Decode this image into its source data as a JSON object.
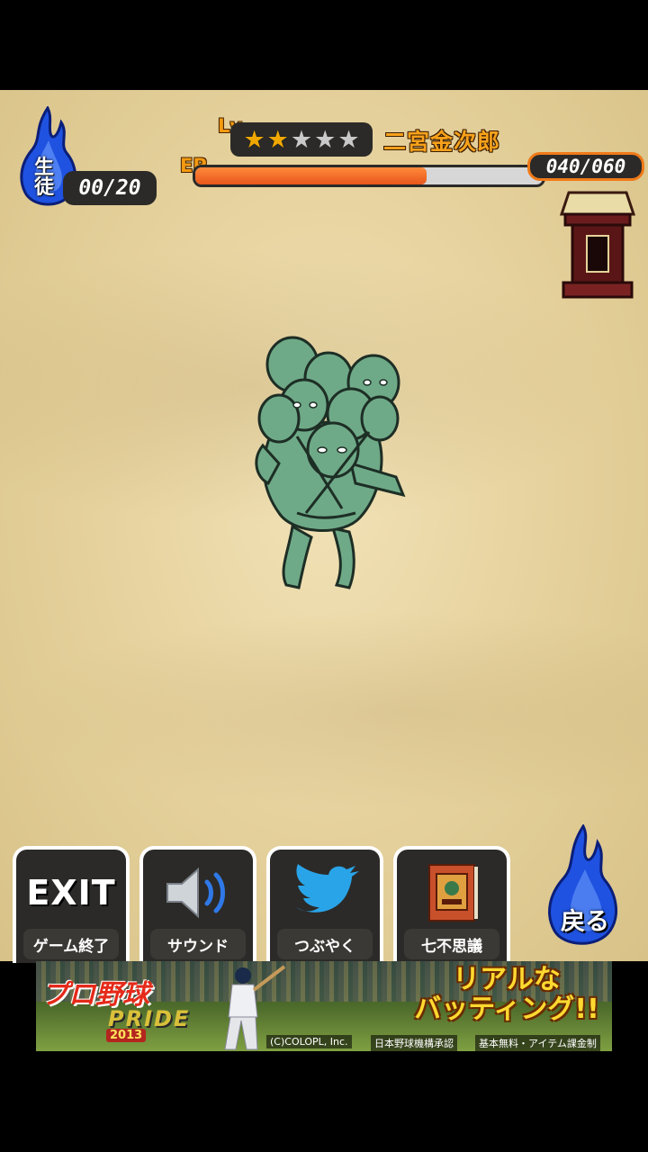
{
  "hud": {
    "students_label": "生徒",
    "students_count": "00/20",
    "lv_label": "Lv",
    "level_stars": 2,
    "level_max": 5,
    "character_name": "二宮金次郎",
    "ep_label": "EP",
    "ep_current": 40,
    "ep_max": 60,
    "ep_value": "040/060"
  },
  "menu": [
    {
      "id": "exit",
      "icon_text": "EXIT",
      "label": "ゲーム終了",
      "icon": "exit-icon"
    },
    {
      "id": "sound",
      "label": "サウンド",
      "icon": "speaker-icon"
    },
    {
      "id": "tweet",
      "label": "つぶやく",
      "icon": "twitter-bird-icon"
    },
    {
      "id": "wonders",
      "label": "七不思議",
      "icon": "book-icon"
    }
  ],
  "back_button": {
    "label": "戻る",
    "icon": "blue-flame-icon"
  },
  "ad": {
    "logo": "プロ野球",
    "logo2": "PRIDE",
    "year": "2013",
    "headline_line1": "リアルな",
    "headline_line2": "バッティング!!",
    "copyright": "(C)COLOPL, Inc.",
    "license": "日本野球機構承認",
    "pricing": "基本無料・アイテム課金制"
  },
  "colors": {
    "accent_orange": "#f39a12",
    "flame_blue": "#1f52e0",
    "panel_dark": "#2b2a28",
    "ep_fill": "#e8561c"
  }
}
